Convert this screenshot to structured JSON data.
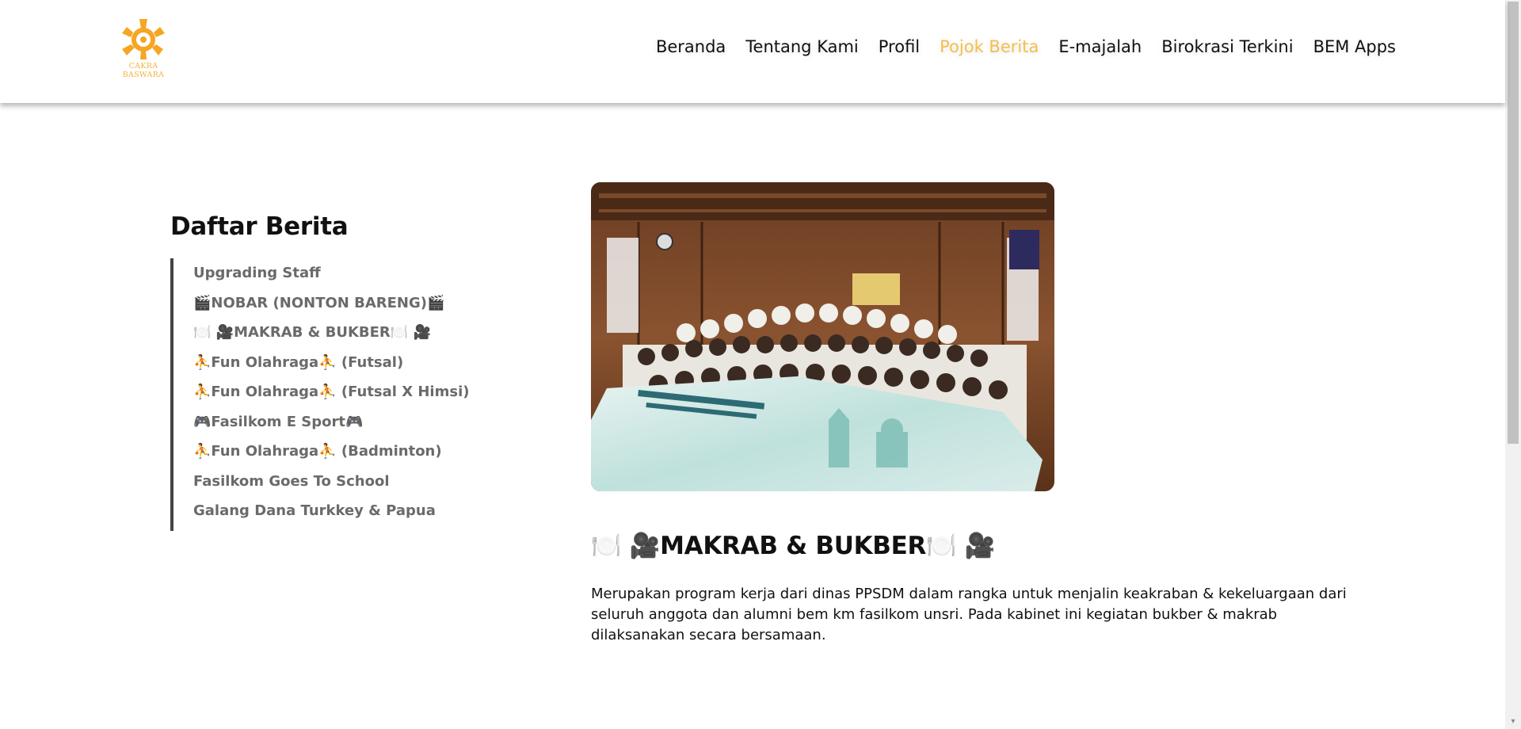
{
  "brand": {
    "logo_line1": "CAKRA",
    "logo_line2": "BASWARA",
    "logo_icon": "cakra-baswara-logo",
    "accent_color": "#f4be4c"
  },
  "nav": {
    "items": [
      {
        "label": "Beranda"
      },
      {
        "label": "Tentang Kami"
      },
      {
        "label": "Profil"
      },
      {
        "label": "Pojok Berita",
        "active": true
      },
      {
        "label": "E-majalah"
      },
      {
        "label": "Birokrasi Terkini"
      },
      {
        "label": "BEM Apps"
      }
    ]
  },
  "sidebar": {
    "title": "Daftar Berita",
    "items": [
      {
        "label": "Upgrading Staff"
      },
      {
        "label": "🎬NOBAR (NONTON BARENG)🎬"
      },
      {
        "label": "🍽️ 🎥MAKRAB & BUKBER🍽️ 🎥"
      },
      {
        "label": "⛹️Fun Olahraga⛹️ (Futsal)"
      },
      {
        "label": "⛹️Fun Olahraga⛹️ (Futsal X Himsi)"
      },
      {
        "label": "🎮Fasilkom E Sport🎮"
      },
      {
        "label": "⛹️Fun Olahraga⛹️ (Badminton)"
      },
      {
        "label": "Fasilkom Goes To School"
      },
      {
        "label": "Galang Dana Turkkey & Papua"
      }
    ]
  },
  "article": {
    "image_icon": "group-photo",
    "title": "🍽️ 🎥MAKRAB & BUKBER🍽️ 🎥",
    "body": "Merupakan program kerja dari dinas PPSDM dalam rangka untuk menjalin keakraban & kekeluargaan dari seluruh anggota dan alumni bem km fasilkom unsri. Pada kabinet ini kegiatan bukber & makrab dilaksanakan secara bersamaan."
  }
}
